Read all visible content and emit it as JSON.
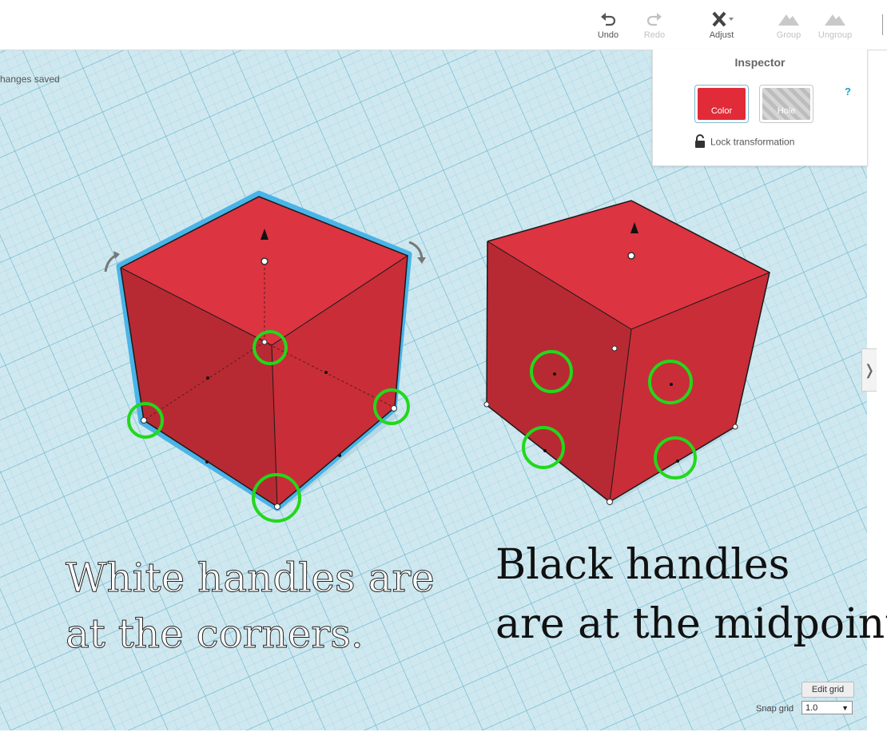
{
  "toolbar": {
    "undo_label": "Undo",
    "redo_label": "Redo",
    "adjust_label": "Adjust",
    "group_label": "Group",
    "ungroup_label": "Ungroup"
  },
  "workplane": {
    "status_text": "hanges saved"
  },
  "inspector": {
    "title": "Inspector",
    "color_label": "Color",
    "hole_label": "Hole",
    "help_label": "?",
    "lock_label": "Lock transformation"
  },
  "grid": {
    "edit_button_label": "Edit grid",
    "snap_label": "Snap grid",
    "snap_value": "1.0"
  },
  "captions": {
    "white_line1": "White handles are",
    "white_line2": "at the corners.",
    "black_line1": "Black handles",
    "black_line2": "are at the midpoint"
  },
  "colors": {
    "box_red": "#e22b38",
    "grid_blue": "#cfe8ef",
    "highlight_green": "#22d81c",
    "selection_blue": "#4ab4e8"
  }
}
